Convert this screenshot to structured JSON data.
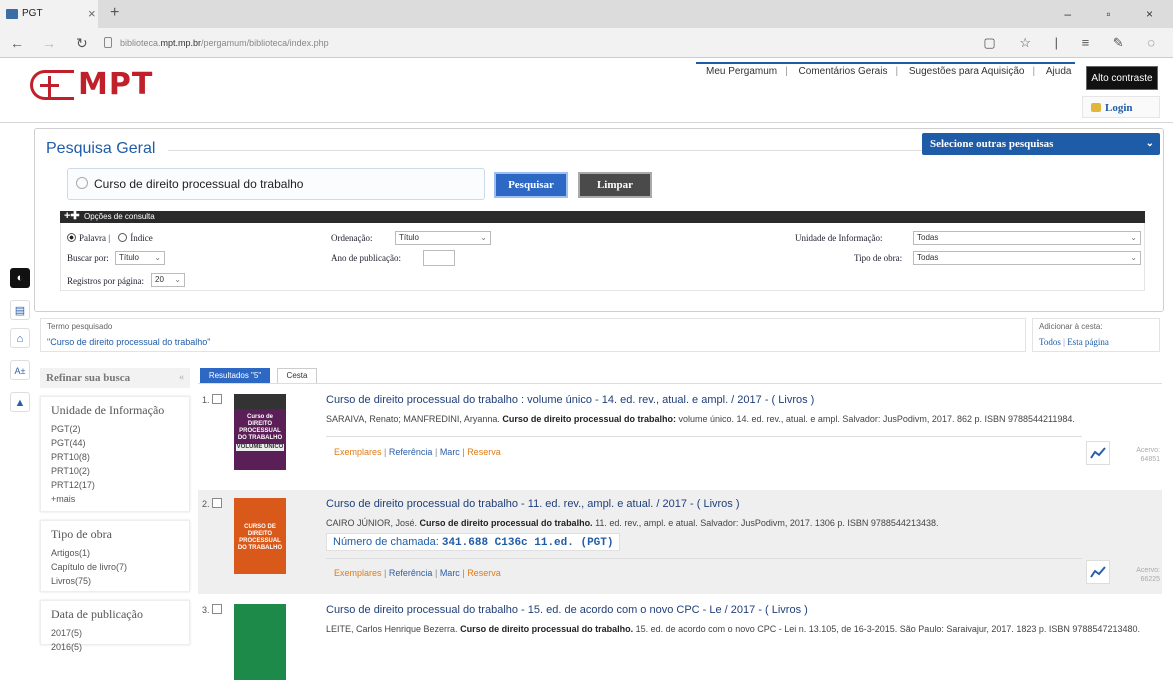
{
  "browser": {
    "tab_title": "PGT",
    "tab_close": "×",
    "new_tab": "+",
    "back": "←",
    "forward": "→",
    "refresh": "↻",
    "url_prefix": "biblioteca.",
    "url_domain": "mpt.mp.br",
    "url_path": "/pergamum/biblioteca/index.php",
    "window_controls": "– ▫ ×",
    "right_icons": "▢ ☆ | ≡ ✎ ◌"
  },
  "header": {
    "logo_text": "MPT",
    "links": [
      "Meu Pergamum",
      "Comentários Gerais",
      "Sugestões para Aquisição",
      "Ajuda"
    ],
    "separator": "|",
    "alto_contraste": "Alto contraste",
    "login": "Login"
  },
  "search": {
    "panel_title": "Pesquisa Geral",
    "outras_pesquisas": "Selecione outras pesquisas",
    "query": "Curso de direito processual do trabalho",
    "pesquisar": "Pesquisar",
    "limpar": "Limpar",
    "opcoes": "Opções de consulta",
    "radio_palavra": "Palavra |",
    "radio_indice": "Índice",
    "buscar_por_label": "Buscar por:",
    "buscar_por_value": "Título",
    "registros_label": "Registros por página:",
    "registros_value": "20",
    "ordenacao_label": "Ordenação:",
    "ordenacao_value": "Título",
    "ano_label": "Ano de publicação:",
    "unidade_label": "Unidade de Informação:",
    "unidade_value": "Todas",
    "tipo_obra_label": "Tipo de obra:",
    "tipo_obra_value": "Todas"
  },
  "termo": {
    "label": "Termo pesquisado",
    "value": "\"Curso de direito processual do trabalho\"",
    "cesta_label": "Adicionar à cesta:",
    "cesta_todos": "Todos",
    "cesta_sep": "|",
    "cesta_pagina": "Esta página"
  },
  "refine": {
    "title": "Refinar sua busca",
    "groups": [
      {
        "heading": "Unidade de Informação",
        "items": [
          "PGT(2)",
          "PGT(44)",
          "PRT10(8)",
          "PRT10(2)",
          "PRT12(17)",
          "+mais"
        ]
      },
      {
        "heading": "Tipo de obra",
        "items": [
          "Artigos(1)",
          "Capítulo de livro(7)",
          "Livros(75)"
        ]
      },
      {
        "heading": "Data de publicação",
        "items": [
          "2017(5)",
          "2016(5)"
        ]
      }
    ]
  },
  "results": {
    "tab_resultados": "Resultados \"5\"",
    "tab_cesta": "Cesta",
    "link_exemplares": "Exemplares",
    "link_referencia": "Referência",
    "link_marc": "Marc",
    "link_reserva": "Reserva",
    "link_sep": "|",
    "acervo_label": "Acervo:",
    "items": [
      {
        "num": "1.",
        "title": "Curso de direito processual do trabalho : volume único - 14. ed. rev., atual. e ampl. / 2017 -  ( Livros )",
        "author": "SARAIVA, Renato; MANFREDINI, Aryanna.",
        "bold": "Curso de direito processual do trabalho:",
        "rest": "volume único. 14. ed. rev., atual. e ampl. Salvador: JusPodivm, 2017. 862 p. ISBN 9788544211984.",
        "acervo": "64851",
        "cover_color": "#5a1f56",
        "cover_lines": [
          "Curso de",
          "DIREITO",
          "PROCESSUAL",
          "DO TRABALHO",
          "VOLUME ÚNICO"
        ]
      },
      {
        "num": "2.",
        "title": "Curso de direito processual do trabalho - 11. ed. rev., ampl. e atual. / 2017 -  ( Livros )",
        "author": "CAIRO JÚNIOR, José.",
        "bold": "Curso de direito processual do trabalho.",
        "rest": "11. ed. rev., ampl. e atual. Salvador: JusPodivm, 2017. 1306 p. ISBN 9788544213438.",
        "chamada_label": "Número de chamada:",
        "chamada_value": "341.688 C136c 11.ed. (PGT)",
        "acervo": "66225",
        "cover_color": "#d9591a",
        "cover_lines": [
          "CURSO DE",
          "DIREITO PROCESSUAL",
          "DO TRABALHO"
        ]
      },
      {
        "num": "3.",
        "title": "Curso de direito processual do trabalho - 15. ed. de acordo com o novo CPC - Le / 2017 -  ( Livros )",
        "author": "LEITE, Carlos Henrique Bezerra.",
        "bold": "Curso de direito processual do trabalho.",
        "rest": "15. ed. de acordo com o novo CPC - Lei n. 13.105, de 16-3-2015. São Paulo: Saraivajur, 2017. 1823 p. ISBN 9788547213480.",
        "cover_color": "#1d8a4a",
        "cover_lines": []
      }
    ]
  },
  "colors": {
    "accent": "#1f5ca8",
    "brand_red": "#c0202a",
    "orange_link": "#e07b16"
  }
}
